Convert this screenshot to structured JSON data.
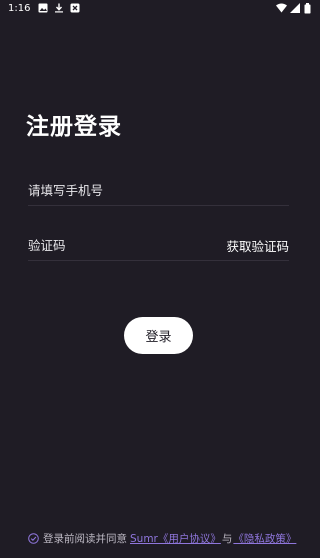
{
  "status_bar": {
    "time": "1:16",
    "left_icons": [
      "image-icon",
      "download-icon",
      "app-icon"
    ],
    "right_icons": [
      "wifi-icon",
      "signal-icon",
      "battery-icon"
    ]
  },
  "title": "注册登录",
  "phone_field": {
    "placeholder": "请填写手机号",
    "value": ""
  },
  "code_field": {
    "placeholder": "验证码",
    "value": "",
    "get_code_label": "获取验证码"
  },
  "login_button": "登录",
  "agreement": {
    "prefix": "登录前阅读并同意",
    "link1": "Sumr《用户协议》",
    "conjunction": "与",
    "link2": "《隐私政策》"
  },
  "colors": {
    "background": "#1f1c25",
    "accent_link": "#8f76dc",
    "button_bg": "#ffffff"
  }
}
